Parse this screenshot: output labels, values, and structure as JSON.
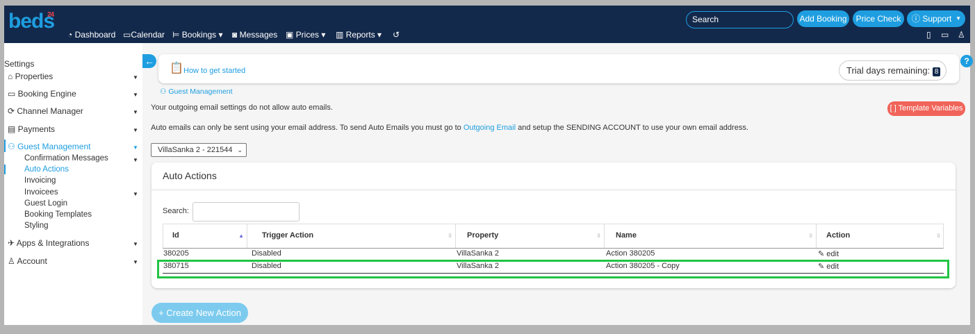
{
  "logo": {
    "text": "beds",
    "sup": "24"
  },
  "nav": {
    "items": [
      "Dashboard",
      "Calendar",
      "Bookings ▾",
      "Messages",
      "Prices ▾",
      "Reports ▾"
    ],
    "search_placeholder": "Search",
    "add_booking": "Add Booking",
    "price_check": "Price Check",
    "support": "Support"
  },
  "sidebar": {
    "title": "Settings",
    "items": [
      "Properties",
      "Booking Engine",
      "Channel Manager",
      "Payments",
      "Guest Management",
      "Apps & Integrations",
      "Account"
    ],
    "sub": [
      "Confirmation Messages",
      "Auto Actions",
      "Invoicing",
      "Invoicees",
      "Guest Login",
      "Booking Templates",
      "Styling"
    ]
  },
  "top": {
    "how_to": "How to get started",
    "trial_label": "Trial days remaining:",
    "trial_days": "8"
  },
  "breadcrumb": "Guest Management",
  "notice1": "Your outgoing email settings do not allow auto emails.",
  "notice2_pre": "Auto emails can only be sent using your email address. To send Auto Emails you must go to ",
  "notice2_link": "Outgoing Email",
  "notice2_post": " and setup the SENDING ACCOUNT to use your own email address.",
  "template_vars": "[ ] Template Variables",
  "property_select": "VillaSanka 2 - 221544",
  "panel": {
    "title": "Auto Actions",
    "search_label": "Search:",
    "columns": [
      "Id",
      "Trigger Action",
      "Property",
      "Name",
      "Action"
    ],
    "rows": [
      {
        "id": "380205",
        "trigger": "Disabled",
        "property": "VillaSanka 2",
        "name": "Action 380205",
        "action": "edit"
      },
      {
        "id": "380715",
        "trigger": "Disabled",
        "property": "VillaSanka 2",
        "name": "Action 380205 - Copy",
        "action": "edit"
      }
    ]
  },
  "create_button": "+ Create New Action",
  "colors": {
    "nav": "#13294b",
    "accent": "#1e9ee0",
    "highlight": "#22c444",
    "template": "#f0645a"
  }
}
